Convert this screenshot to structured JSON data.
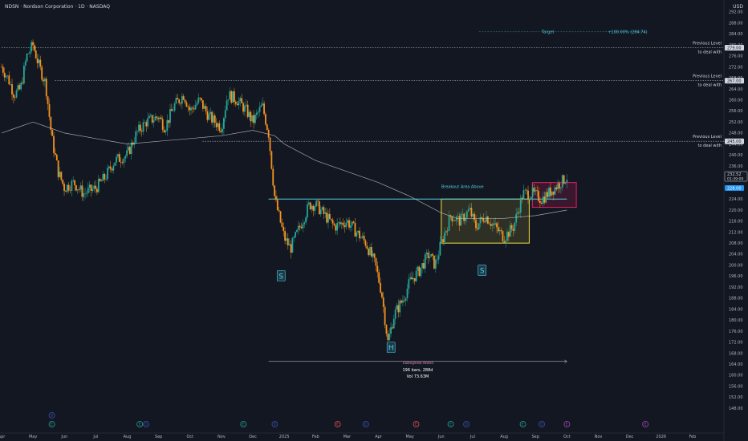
{
  "header": {
    "title": "NDSN · Nordson Corporation · 1D · NASDAQ",
    "currency": "USD"
  },
  "colors": {
    "background": "#131722",
    "up": "#26a69a",
    "down": "#f7931e",
    "ma": "#c9c9c9",
    "neckline": "#4dd0e1",
    "box1": "#f5e342",
    "box2": "#e91e63",
    "dotted": "#b2b5be",
    "label_cyan": "#4dd0e1"
  },
  "chart_data": {
    "type": "candlestick",
    "title": "NDSN · Nordson Corporation · 1D · NASDAQ",
    "ylim": [
      146,
      294
    ],
    "y_ticks": [
      148,
      152,
      156,
      160,
      164,
      168,
      172,
      176,
      180,
      184,
      188,
      192,
      196,
      200,
      204,
      208,
      212,
      216,
      220,
      224,
      228,
      232,
      236,
      240,
      244,
      248,
      252,
      256,
      260,
      264,
      268,
      272,
      276,
      280,
      284,
      288,
      292
    ],
    "x_labels": [
      {
        "label": "Apr",
        "t": 0
      },
      {
        "label": "May",
        "t": 1
      },
      {
        "label": "Jun",
        "t": 2
      },
      {
        "label": "Jul",
        "t": 3
      },
      {
        "label": "Aug",
        "t": 4
      },
      {
        "label": "Sep",
        "t": 5
      },
      {
        "label": "Oct",
        "t": 6
      },
      {
        "label": "Nov",
        "t": 7
      },
      {
        "label": "Dec",
        "t": 8
      },
      {
        "label": "2025",
        "t": 9
      },
      {
        "label": "Feb",
        "t": 10
      },
      {
        "label": "Mar",
        "t": 11
      },
      {
        "label": "Apr",
        "t": 12
      },
      {
        "label": "May",
        "t": 13
      },
      {
        "label": "Jun",
        "t": 14
      },
      {
        "label": "Jul",
        "t": 15
      },
      {
        "label": "Aug",
        "t": 16
      },
      {
        "label": "Sep",
        "t": 17
      },
      {
        "label": "Oct",
        "t": 18
      },
      {
        "label": "Nov",
        "t": 19
      },
      {
        "label": "Dec",
        "t": 20
      },
      {
        "label": "2026",
        "t": 21
      },
      {
        "label": "Feb",
        "t": 22
      }
    ],
    "price_path": [
      [
        0.0,
        272
      ],
      [
        0.2,
        268
      ],
      [
        0.4,
        262
      ],
      [
        0.6,
        264
      ],
      [
        0.8,
        276
      ],
      [
        1.0,
        280
      ],
      [
        1.2,
        272
      ],
      [
        1.4,
        266
      ],
      [
        1.6,
        246
      ],
      [
        1.8,
        234
      ],
      [
        2.0,
        228
      ],
      [
        2.3,
        230
      ],
      [
        2.6,
        226
      ],
      [
        3.0,
        228
      ],
      [
        3.3,
        232
      ],
      [
        3.6,
        238
      ],
      [
        4.0,
        240
      ],
      [
        4.3,
        248
      ],
      [
        4.6,
        252
      ],
      [
        5.0,
        254
      ],
      [
        5.2,
        250
      ],
      [
        5.5,
        258
      ],
      [
        5.8,
        262
      ],
      [
        6.0,
        256
      ],
      [
        6.3,
        260
      ],
      [
        6.6,
        254
      ],
      [
        7.0,
        250
      ],
      [
        7.2,
        262
      ],
      [
        7.5,
        260
      ],
      [
        7.8,
        256
      ],
      [
        8.0,
        252
      ],
      [
        8.3,
        258
      ],
      [
        8.5,
        248
      ],
      [
        8.7,
        224
      ],
      [
        9.0,
        210
      ],
      [
        9.2,
        206
      ],
      [
        9.5,
        214
      ],
      [
        9.8,
        222
      ],
      [
        10.0,
        222
      ],
      [
        10.3,
        218
      ],
      [
        10.6,
        214
      ],
      [
        11.0,
        216
      ],
      [
        11.3,
        212
      ],
      [
        11.6,
        208
      ],
      [
        11.9,
        200
      ],
      [
        12.1,
        190
      ],
      [
        12.3,
        172
      ],
      [
        12.5,
        182
      ],
      [
        12.8,
        188
      ],
      [
        13.0,
        194
      ],
      [
        13.3,
        198
      ],
      [
        13.6,
        204
      ],
      [
        13.8,
        200
      ],
      [
        14.0,
        208
      ],
      [
        14.3,
        218
      ],
      [
        14.6,
        216
      ],
      [
        14.9,
        220
      ],
      [
        15.1,
        214
      ],
      [
        15.4,
        218
      ],
      [
        15.7,
        214
      ],
      [
        16.0,
        210
      ],
      [
        16.3,
        214
      ],
      [
        16.6,
        226
      ],
      [
        16.9,
        226
      ],
      [
        17.2,
        224
      ],
      [
        17.6,
        228
      ],
      [
        18.0,
        232
      ]
    ],
    "ma_path": [
      [
        0.0,
        248
      ],
      [
        0.5,
        250
      ],
      [
        1.0,
        252
      ],
      [
        1.5,
        250
      ],
      [
        2.0,
        248
      ],
      [
        3.0,
        246
      ],
      [
        4.0,
        244
      ],
      [
        5.0,
        245
      ],
      [
        6.0,
        246
      ],
      [
        7.0,
        247
      ],
      [
        8.0,
        249
      ],
      [
        8.7,
        247
      ],
      [
        9.0,
        244
      ],
      [
        9.5,
        241
      ],
      [
        10.0,
        238
      ],
      [
        11.0,
        234
      ],
      [
        12.0,
        230
      ],
      [
        13.0,
        225
      ],
      [
        14.0,
        219
      ],
      [
        14.5,
        217
      ],
      [
        15.0,
        217
      ],
      [
        16.0,
        217
      ],
      [
        17.0,
        218
      ],
      [
        18.0,
        220
      ]
    ],
    "levels": [
      {
        "price": 279.0,
        "label": "Previous Level to deal with"
      },
      {
        "price": 267.0,
        "label": "Previous Level to deal with"
      },
      {
        "price": 245.0,
        "label": "Previous Level to deal with"
      }
    ],
    "neckline": {
      "price": 224.0,
      "t_start": 8.5,
      "t_end": 18.0,
      "label": "Breakout Area Above"
    },
    "target": {
      "price": 284.74,
      "label": "Target",
      "value_label": "+100.00% (284.74)"
    },
    "box1": {
      "t0": 14.0,
      "t1": 16.8,
      "p_top": 224.0,
      "p_bottom": 208.0
    },
    "box2": {
      "t0": 16.9,
      "t1": 18.3,
      "p_top": 230.0,
      "p_bottom": 221.0
    },
    "last_price": {
      "price": 232.52,
      "label": "232.52",
      "countdown": "01:39:09"
    },
    "level_228": {
      "price": 228.0,
      "label": "228.00"
    },
    "axis_level_labels": [
      {
        "price": 279.0,
        "label": "279.00"
      },
      {
        "price": 267.0,
        "label": "267.00"
      },
      {
        "price": 245.0,
        "label": "245.00"
      }
    ],
    "pattern_labels": [
      {
        "text": "S",
        "t": 8.9,
        "price": 196
      },
      {
        "text": "H",
        "t": 12.4,
        "price": 170
      },
      {
        "text": "S",
        "t": 15.3,
        "price": 198
      }
    ],
    "measure": {
      "label": "TradingView Posted",
      "bars": "196 bars, 288d",
      "vol": "Vol 73.63M",
      "t0": 8.5,
      "t1": 18.0,
      "price": 165
    },
    "events": [
      {
        "t": 1.6,
        "label": "D",
        "kind": "dividend"
      },
      {
        "t": 1.6,
        "label": "E",
        "kind": "earnings"
      },
      {
        "t": 4.4,
        "label": "E",
        "kind": "earnings"
      },
      {
        "t": 4.6,
        "label": "D",
        "kind": "dividend"
      },
      {
        "t": 7.7,
        "label": "E",
        "kind": "earnings"
      },
      {
        "t": 8.7,
        "label": "D",
        "kind": "dividend"
      },
      {
        "t": 10.7,
        "label": "E",
        "kind": "earnings-red"
      },
      {
        "t": 11.6,
        "label": "D",
        "kind": "dividend"
      },
      {
        "t": 13.2,
        "label": "E",
        "kind": "earnings-red"
      },
      {
        "t": 14.3,
        "label": "E",
        "kind": "earnings"
      },
      {
        "t": 14.8,
        "label": "D",
        "kind": "dividend"
      },
      {
        "t": 16.6,
        "label": "E",
        "kind": "earnings"
      },
      {
        "t": 17.2,
        "label": "D",
        "kind": "dividend"
      },
      {
        "t": 18.0,
        "label": "E",
        "kind": "earnings-purple"
      },
      {
        "t": 20.5,
        "label": "E",
        "kind": "earnings-purple"
      }
    ]
  }
}
